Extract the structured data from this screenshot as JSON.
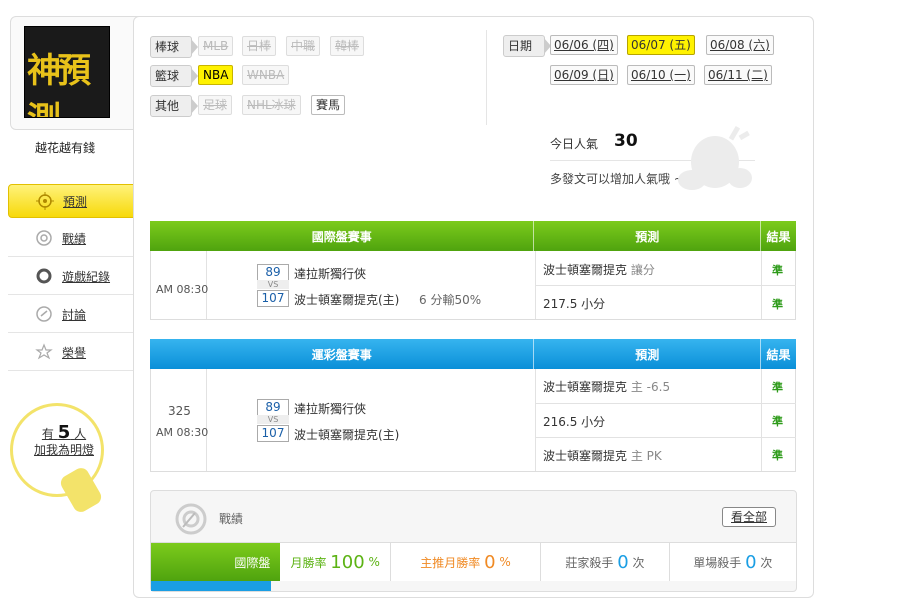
{
  "user": {
    "name": "越花越有錢",
    "avatar_text": "神預測"
  },
  "left_nav": [
    {
      "label": "預測",
      "icon": "crosshair-icon",
      "active": true
    },
    {
      "label": "戰績",
      "icon": "target-icon"
    },
    {
      "label": "遊戲紀錄",
      "icon": "ring-icon"
    },
    {
      "label": "討論",
      "icon": "chat-icon"
    },
    {
      "label": "榮譽",
      "icon": "medal-icon"
    }
  ],
  "fans": {
    "prefix": "有",
    "count": "5",
    "suffix": "人",
    "cta": "加我為明燈"
  },
  "sport_rows": [
    {
      "label": "棒球",
      "tags": [
        "MLB",
        "日棒",
        "中職",
        "韓棒"
      ]
    },
    {
      "label": "籃球",
      "tags": [
        "NBA",
        "WNBA"
      ]
    },
    {
      "label": "其他",
      "tags": [
        "足球",
        "NHL冰球",
        "賽馬"
      ]
    }
  ],
  "dates": {
    "label": "日期",
    "row1": [
      "06/06 (四)",
      "06/07 (五)",
      "06/08 (六)"
    ],
    "row2": [
      "06/09 (日)",
      "06/10 (一)",
      "06/11 (二)"
    ]
  },
  "popularity": {
    "label": "今日人氣",
    "value": "30",
    "hint": "多發文可以增加人氣哦 ~"
  },
  "intl_table": {
    "headers": [
      "國際盤賽事",
      "預測",
      "結果"
    ],
    "time": "AM 08:30",
    "away": {
      "score": "89",
      "team": "達拉斯獨行俠"
    },
    "vs": "VS",
    "home": {
      "score": "107",
      "team": "波士頓塞爾提克(主)",
      "note": "6 分輸50%"
    },
    "preds": [
      {
        "pick": "波士頓塞爾提克",
        "detail": "讓分",
        "result": "準"
      },
      {
        "pick": "217.5 小分",
        "detail": "",
        "result": "準"
      }
    ]
  },
  "lottery_table": {
    "headers": [
      "運彩盤賽事",
      "預測",
      "結果"
    ],
    "game_no": "325",
    "time": "AM 08:30",
    "away": {
      "score": "89",
      "team": "達拉斯獨行俠"
    },
    "vs": "VS",
    "home": {
      "score": "107",
      "team": "波士頓塞爾提克(主)"
    },
    "preds": [
      {
        "pick": "波士頓塞爾提克",
        "detail": "主 -6.5",
        "result": "準"
      },
      {
        "pick": "216.5 小分",
        "detail": "",
        "result": "準"
      },
      {
        "pick": "波士頓塞爾提克",
        "detail": "主 PK",
        "result": "準"
      }
    ]
  },
  "stats": {
    "title": "戰績",
    "view_all": "看全部",
    "row_label": "國際盤",
    "items": [
      {
        "label": "月勝率",
        "value": "100",
        "unit": "%"
      },
      {
        "label": "主推月勝率",
        "value": "0",
        "unit": "%"
      },
      {
        "label": "莊家殺手",
        "value": "0",
        "unit": "次"
      },
      {
        "label": "單場殺手",
        "value": "0",
        "unit": "次"
      }
    ]
  },
  "colors": {
    "green": "#5cb314",
    "blue": "#1a9ee4",
    "yellow": "#fff200"
  }
}
